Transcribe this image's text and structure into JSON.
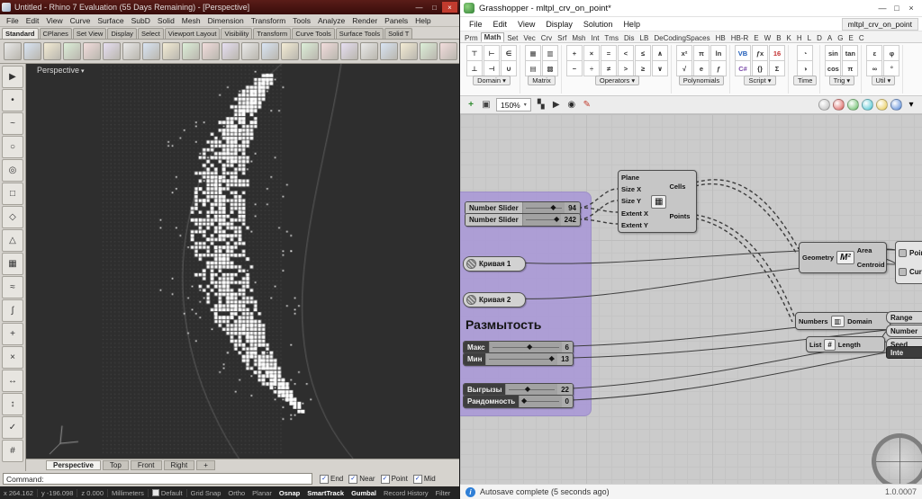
{
  "rhino": {
    "title": "Untitled - Rhino 7 Evaluation (55 Days Remaining) - [Perspective]",
    "menus": [
      "File",
      "Edit",
      "View",
      "Curve",
      "Surface",
      "SubD",
      "Solid",
      "Mesh",
      "Dimension",
      "Transform",
      "Tools",
      "Analyze",
      "Render",
      "Panels",
      "Help"
    ],
    "toolbar_tabs": [
      "Standard",
      "CPlanes",
      "Set View",
      "Display",
      "Select",
      "Viewport Layout",
      "Visibility",
      "Transform",
      "Curve Tools",
      "Surface Tools",
      "Solid T"
    ],
    "active_toolbar_tab": "Standard",
    "toolbar_icons": [
      "new-file-icon",
      "open-file-icon",
      "save-icon",
      "print-icon",
      "cut-icon",
      "copy-icon",
      "paste-icon",
      "undo-icon",
      "redo-icon",
      "pan-view-icon",
      "zoom-window-icon",
      "zoom-extents-icon",
      "rotate-view-icon",
      "move-icon",
      "copy-object-icon",
      "rotate-icon",
      "scale-icon",
      "mirror-icon",
      "trim-icon",
      "split-icon",
      "join-icon",
      "explode-icon",
      "group-icon",
      "hide-icon",
      "lock-icon",
      "layers-icon",
      "properties-icon"
    ],
    "side_icons": [
      "select-arrow-icon",
      "point-icon",
      "freeform-curve-icon",
      "circle-icon",
      "arc-icon",
      "rectangle-icon",
      "polygon-icon",
      "curve-tools-icon",
      "surface-icon",
      "solid-icon",
      "mesh-icon",
      "transform-icon",
      "curve-edit-icon",
      "analyze-icon",
      "render-tools-icon",
      "drafting-icon",
      "visibility-icon"
    ],
    "viewport": {
      "label": "Perspective",
      "tabs": [
        "Perspective",
        "Top",
        "Front",
        "Right"
      ],
      "new_tab_label": "+"
    },
    "command_prompt": "Command:",
    "osnap_toggles": [
      {
        "label": "End",
        "checked": true
      },
      {
        "label": "Near",
        "checked": true
      },
      {
        "label": "Point",
        "checked": true
      },
      {
        "label": "Mid",
        "checked": true
      }
    ],
    "status": {
      "x": "x 264.162",
      "y": "y -196.098",
      "z": "z 0.000",
      "units": "Millimeters",
      "layer": "Default",
      "toggles": [
        {
          "label": "Grid Snap",
          "on": false
        },
        {
          "label": "Ortho",
          "on": false
        },
        {
          "label": "Planar",
          "on": false
        },
        {
          "label": "Osnap",
          "on": true
        },
        {
          "label": "SmartTrack",
          "on": true
        },
        {
          "label": "Gumbal",
          "on": true
        },
        {
          "label": "Record History",
          "on": false
        },
        {
          "label": "Filter",
          "on": false
        }
      ]
    }
  },
  "grasshopper": {
    "title": "Grasshopper - mltpl_crv_on_point*",
    "doc_tab": "mltpl_crv_on_point",
    "menus": [
      "File",
      "Edit",
      "View",
      "Display",
      "Solution",
      "Help"
    ],
    "category_tabs": [
      "Prm",
      "Math",
      "Set",
      "Vec",
      "Crv",
      "Srf",
      "Msh",
      "Int",
      "Tms",
      "Dis",
      "LB",
      "DeCodingSpaces",
      "HB",
      "HB-R",
      "E",
      "W",
      "B",
      "K",
      "H",
      "L",
      "D",
      "A",
      "G",
      "E",
      "C"
    ],
    "active_category_tab": "Math",
    "palette": [
      {
        "label": "Domain",
        "arrow": true,
        "icons": [
          "⊤",
          "⊥",
          "⊢",
          "⊣",
          "∈",
          "∪"
        ]
      },
      {
        "label": "Matrix",
        "arrow": false,
        "icons": [
          "▦",
          "▤",
          "▥",
          "▩"
        ]
      },
      {
        "label": "Operators",
        "arrow": true,
        "icons": [
          "+",
          "−",
          "×",
          "÷",
          "=",
          "≠",
          "<",
          ">",
          "≤",
          "≥",
          "∧",
          "∨"
        ]
      },
      {
        "label": "Polynomials",
        "arrow": false,
        "icons": [
          "x²",
          "√",
          "π",
          "e",
          "ln",
          "ƒ"
        ]
      },
      {
        "label": "Script",
        "arrow": true,
        "icons": [
          {
            "g": "VB",
            "c": "#1d5bb8"
          },
          {
            "g": "C#",
            "c": "#7a4aa8"
          },
          {
            "g": "ƒx",
            "c": "#333333"
          },
          {
            "g": "{}",
            "c": "#333333"
          },
          {
            "g": "16",
            "c": "#c23030"
          },
          {
            "g": "Σ",
            "c": "#333333"
          }
        ]
      },
      {
        "label": "Time",
        "arrow": false,
        "icons": [
          "◔",
          "◑"
        ]
      },
      {
        "label": "Trig",
        "arrow": true,
        "icons": [
          "sin",
          "cos",
          "tan",
          "π"
        ]
      },
      {
        "label": "Util",
        "arrow": true,
        "icons": [
          "ε",
          "∞",
          "φ",
          "°"
        ]
      }
    ],
    "canvas_toolbar": {
      "zoom": "150%"
    },
    "canvas": {
      "sliders_top": [
        {
          "name": "Number Slider",
          "value": "94"
        },
        {
          "name": "Number Slider",
          "value": "242"
        }
      ],
      "grid_component": {
        "icon": "▦",
        "inputs": [
          "Plane",
          "Size X",
          "Size Y",
          "Extent X",
          "Extent Y"
        ],
        "outputs": [
          "Cells",
          "Points"
        ]
      },
      "curve_params": [
        "Кривая 1",
        "Кривая 2"
      ],
      "group_label": "Размытость",
      "group_sliders": [
        {
          "name": "Макс",
          "value": "6"
        },
        {
          "name": "Мин",
          "value": "13"
        }
      ],
      "bottom_sliders": [
        {
          "name": "Выгрызы",
          "value": "22"
        },
        {
          "name": "Рандомность",
          "value": "0"
        }
      ],
      "area_component": {
        "input": "Geometry",
        "icon": "M²",
        "outputs": [
          "Area",
          "Centroid"
        ]
      },
      "domain_component": {
        "input": "Numbers",
        "icon": "▥",
        "output": "Domain"
      },
      "length_component": {
        "input": "List",
        "icon": "#",
        "output": "Length"
      },
      "right_point_params": [
        "Point",
        "Curve"
      ],
      "right_params": [
        "Range",
        "Number",
        "Seed"
      ],
      "right_partial_label": "Inte"
    },
    "statusbar": {
      "message": "Autosave complete (5 seconds ago)",
      "version": "1.0.0007"
    }
  }
}
